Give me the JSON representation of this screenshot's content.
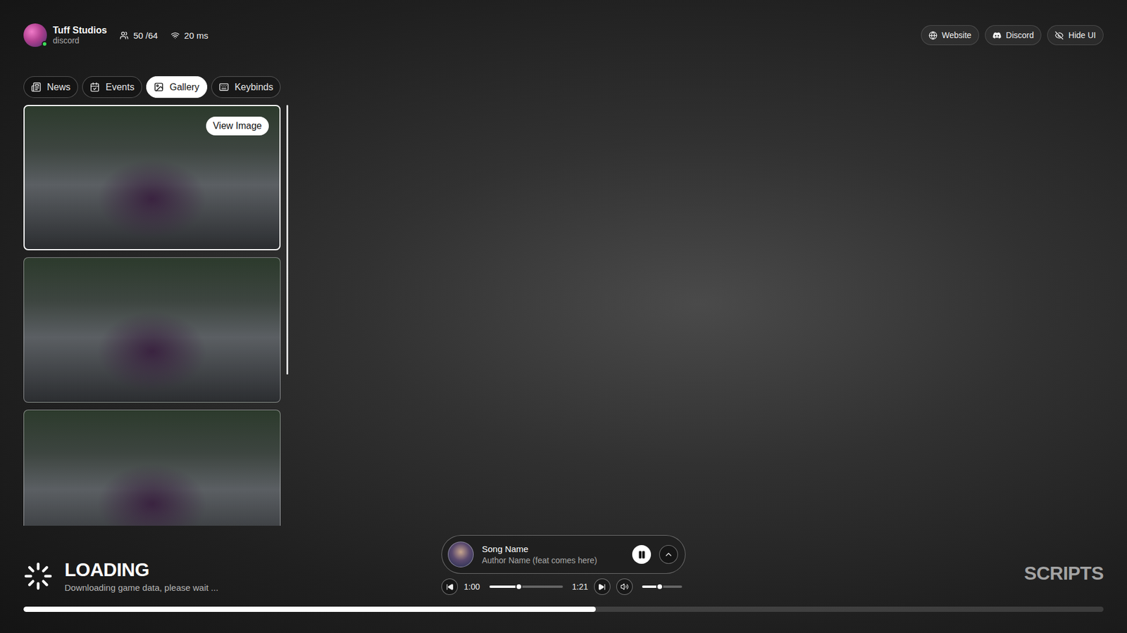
{
  "server": {
    "name": "Tuff Studios",
    "subtitle": "discord",
    "online": true,
    "players": "50 /64",
    "ping": "20 ms"
  },
  "links": [
    {
      "label": "Website"
    },
    {
      "label": "Discord"
    },
    {
      "label": "Hide UI"
    }
  ],
  "tabs": [
    {
      "label": "News",
      "selected": false
    },
    {
      "label": "Events",
      "selected": false
    },
    {
      "label": "Gallery",
      "selected": true
    },
    {
      "label": "Keybinds",
      "selected": false
    }
  ],
  "gallery": {
    "action": "View Image",
    "items": [
      {
        "selected": true
      },
      {
        "selected": false
      },
      {
        "selected": false
      }
    ]
  },
  "loading": {
    "title": "LOADING",
    "message": "Downloading game data, please wait ...",
    "level": 0.53
  },
  "player": {
    "song": "Song Name",
    "author": "Author Name (feat comes here)",
    "playing": true,
    "expanded": false,
    "elapsed": "1:00",
    "duration": "1:21",
    "level": 0.4,
    "volume": 0.45
  },
  "brand": "SCRIPTS"
}
